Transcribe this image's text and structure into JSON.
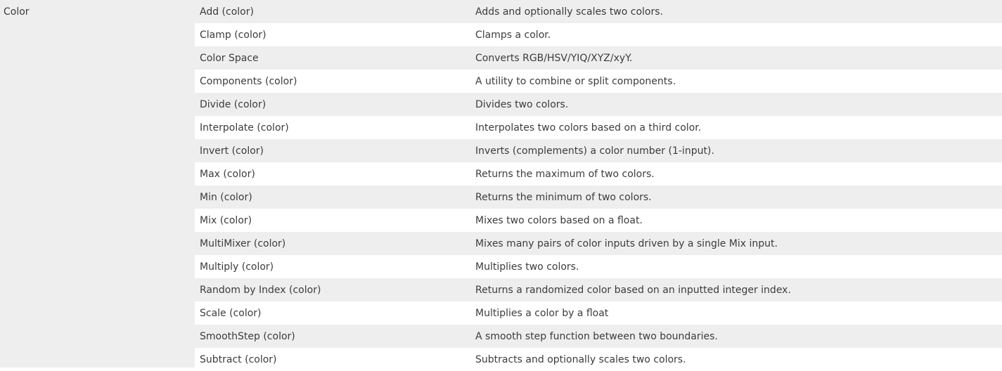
{
  "category": "Color",
  "rows": [
    {
      "name": "Add (color)",
      "description": "Adds and optionally scales two colors."
    },
    {
      "name": "Clamp (color)",
      "description": "Clamps a color."
    },
    {
      "name": "Color Space",
      "description": "Converts RGB/HSV/YIQ/XYZ/xyY."
    },
    {
      "name": "Components (color)",
      "description": "A utility to combine or split components."
    },
    {
      "name": "Divide (color)",
      "description": "Divides two colors."
    },
    {
      "name": "Interpolate (color)",
      "description": "Interpolates two colors based on a third color."
    },
    {
      "name": "Invert (color)",
      "description": "Inverts (complements) a color number (1-input)."
    },
    {
      "name": "Max (color)",
      "description": "Returns the maximum of two colors."
    },
    {
      "name": "Min (color)",
      "description": "Returns the minimum of two colors."
    },
    {
      "name": "Mix (color)",
      "description": "Mixes two colors based on a float."
    },
    {
      "name": "MultiMixer (color)",
      "description": "Mixes many pairs of color inputs driven by a single Mix input."
    },
    {
      "name": "Multiply (color)",
      "description": "Multiplies two colors."
    },
    {
      "name": "Random by Index (color)",
      "description": "Returns a randomized color based on an inputted integer index."
    },
    {
      "name": "Scale (color)",
      "description": "Multiplies a color by a float"
    },
    {
      "name": "SmoothStep (color)",
      "description": "A smooth step function between two boundaries."
    },
    {
      "name": "Subtract (color)",
      "description": "Subtracts and optionally scales two colors."
    }
  ]
}
